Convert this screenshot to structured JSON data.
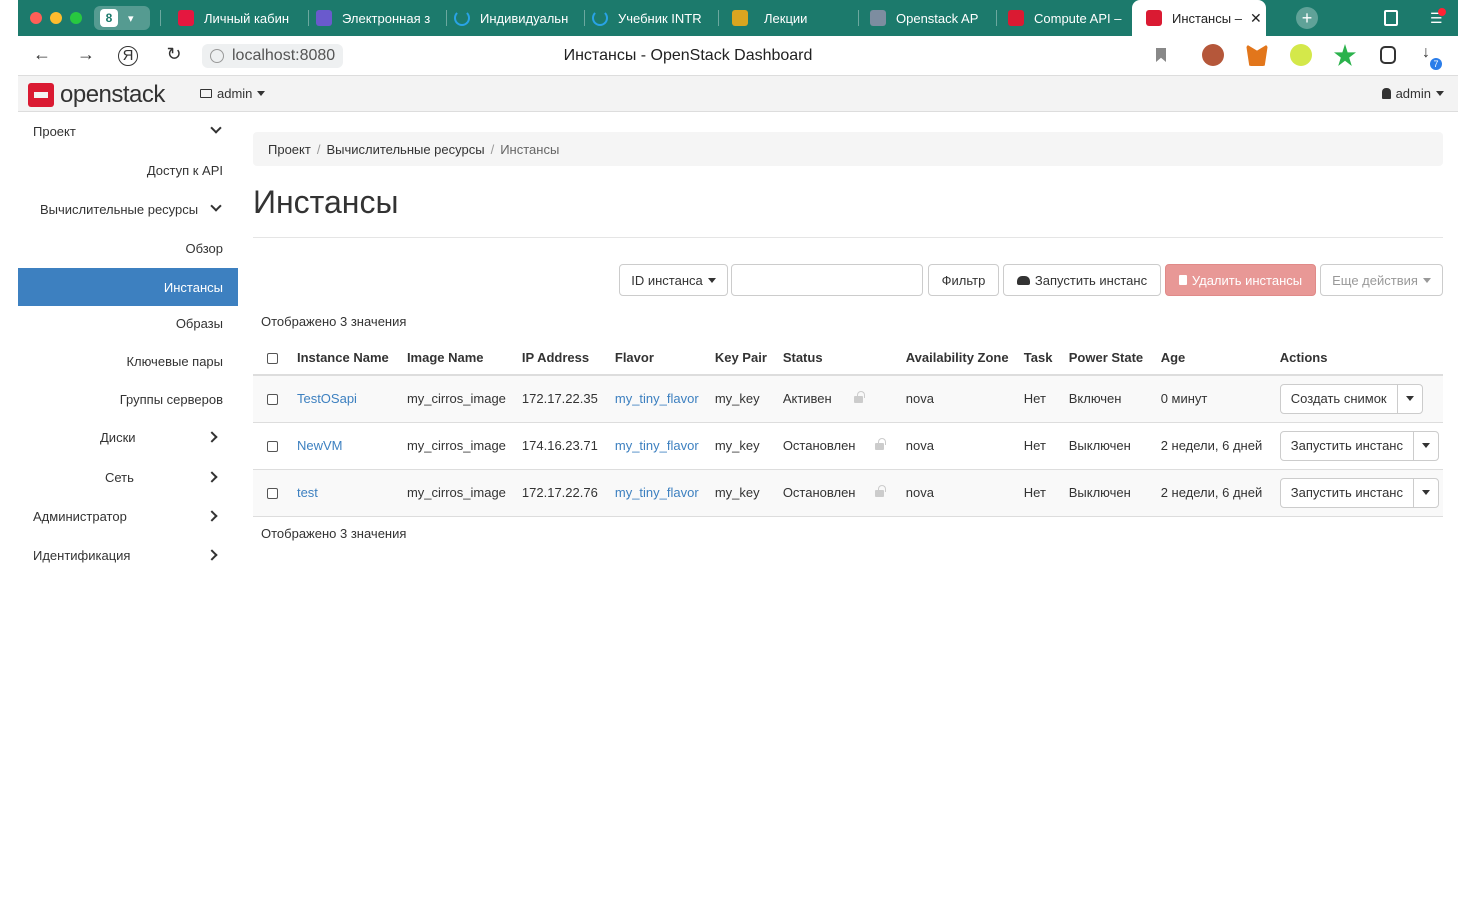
{
  "browser": {
    "tab_count": "8",
    "tabs": [
      {
        "label": "Личный кабин",
        "fav_color": "#e5173f"
      },
      {
        "label": "Электронная з",
        "fav_color": "#6a5acd"
      },
      {
        "label": "Индивидуальн",
        "fav_color": "#29a3e6"
      },
      {
        "label": "Учебник INTR",
        "fav_color": "#29a3e6"
      },
      {
        "label": "Лекции",
        "fav_color": "#d9a520"
      },
      {
        "label": "Openstack AP",
        "fav_color": "#7d8da0"
      },
      {
        "label": "Compute API –",
        "fav_color": "#da1a32"
      },
      {
        "label": "Инстансы –",
        "fav_color": "#da1a32"
      }
    ],
    "url": "localhost:8080",
    "page_title": "Инстансы - OpenStack Dashboard",
    "download_badge": "7",
    "accent": "#1c7a6c"
  },
  "header": {
    "logo_text": "openstack",
    "project": "admin",
    "user": "admin"
  },
  "sidebar": {
    "project": "Проект",
    "api_access": "Доступ к API",
    "compute": "Вычислительные ресурсы",
    "overview": "Обзор",
    "instances": "Инстансы",
    "images": "Образы",
    "key_pairs": "Ключевые пары",
    "server_groups": "Группы серверов",
    "volumes": "Диски",
    "network": "Сеть",
    "admin": "Администратор",
    "identity": "Идентификация"
  },
  "breadcrumb": [
    "Проект",
    "Вычислительные ресурсы",
    "Инстансы"
  ],
  "page": {
    "title": "Инстансы",
    "filter_select": "ID инстанса",
    "filter_input_value": "",
    "filter_button": "Фильтр",
    "launch_button": "Запустить инстанс",
    "delete_button": "Удалить инстансы",
    "more_button": "Еще действия",
    "count_top": "Отображено 3 значения",
    "count_bottom": "Отображено 3 значения"
  },
  "table": {
    "columns": [
      "Instance Name",
      "Image Name",
      "IP Address",
      "Flavor",
      "Key Pair",
      "Status",
      "Availability Zone",
      "Task",
      "Power State",
      "Age",
      "Actions"
    ],
    "rows": [
      {
        "name": "TestOSapi",
        "image": "my_cirros_image",
        "ip": "172.17.22.35",
        "flavor": "my_tiny_flavor",
        "key": "my_key",
        "status": "Активен",
        "zone": "nova",
        "task": "Нет",
        "power": "Включен",
        "age": "0 минут",
        "action": "Создать снимок"
      },
      {
        "name": "NewVM",
        "image": "my_cirros_image",
        "ip": "174.16.23.71",
        "flavor": "my_tiny_flavor",
        "key": "my_key",
        "status": "Остановлен",
        "zone": "nova",
        "task": "Нет",
        "power": "Выключен",
        "age": "2 недели, 6 дней",
        "action": "Запустить инстанс"
      },
      {
        "name": "test",
        "image": "my_cirros_image",
        "ip": "172.17.22.76",
        "flavor": "my_tiny_flavor",
        "key": "my_key",
        "status": "Остановлен",
        "zone": "nova",
        "task": "Нет",
        "power": "Выключен",
        "age": "2 недели, 6 дней",
        "action": "Запустить инстанс"
      }
    ]
  }
}
